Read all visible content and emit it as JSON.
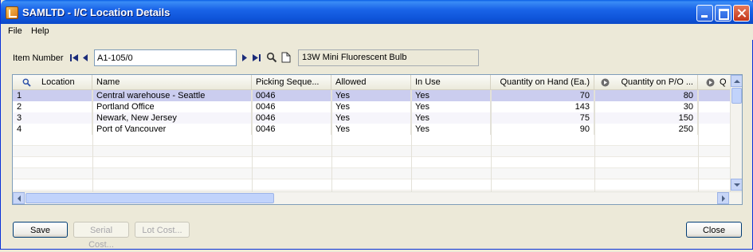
{
  "window": {
    "title": "SAMLTD - I/C Location Details"
  },
  "menu": {
    "file": "File",
    "help": "Help"
  },
  "item": {
    "label": "Item Number",
    "value": "A1-105/0",
    "description": "13W Mini Fluorescent Bulb"
  },
  "grid": {
    "columns": {
      "location": "Location",
      "name": "Name",
      "picking": "Picking Seque...",
      "allowed": "Allowed",
      "in_use": "In Use",
      "qoh": "Quantity on Hand (Ea.)",
      "qpo": "Quantity on P/O ...",
      "more": "Q"
    },
    "rows": [
      {
        "location": "1",
        "name": "Central warehouse - Seattle",
        "picking": "0046",
        "allowed": "Yes",
        "in_use": "Yes",
        "qoh": "70",
        "qpo": "80"
      },
      {
        "location": "2",
        "name": "Portland Office",
        "picking": "0046",
        "allowed": "Yes",
        "in_use": "Yes",
        "qoh": "143",
        "qpo": "30"
      },
      {
        "location": "3",
        "name": "Newark, New Jersey",
        "picking": "0046",
        "allowed": "Yes",
        "in_use": "Yes",
        "qoh": "75",
        "qpo": "150"
      },
      {
        "location": "4",
        "name": "Port of Vancouver",
        "picking": "0046",
        "allowed": "Yes",
        "in_use": "Yes",
        "qoh": "90",
        "qpo": "250"
      }
    ]
  },
  "buttons": {
    "save": "Save",
    "serial_cost": "Serial Cost...",
    "lot_cost": "Lot Cost...",
    "close": "Close"
  },
  "colors": {
    "title_bar": "#0f55da",
    "selected_row": "#cbcdef",
    "window_bg": "#ece9d8"
  },
  "icons": [
    "app-icon",
    "minimize-icon",
    "maximize-icon",
    "close-icon",
    "first-record-icon",
    "previous-record-icon",
    "next-record-icon",
    "last-record-icon",
    "search-icon",
    "document-icon"
  ]
}
